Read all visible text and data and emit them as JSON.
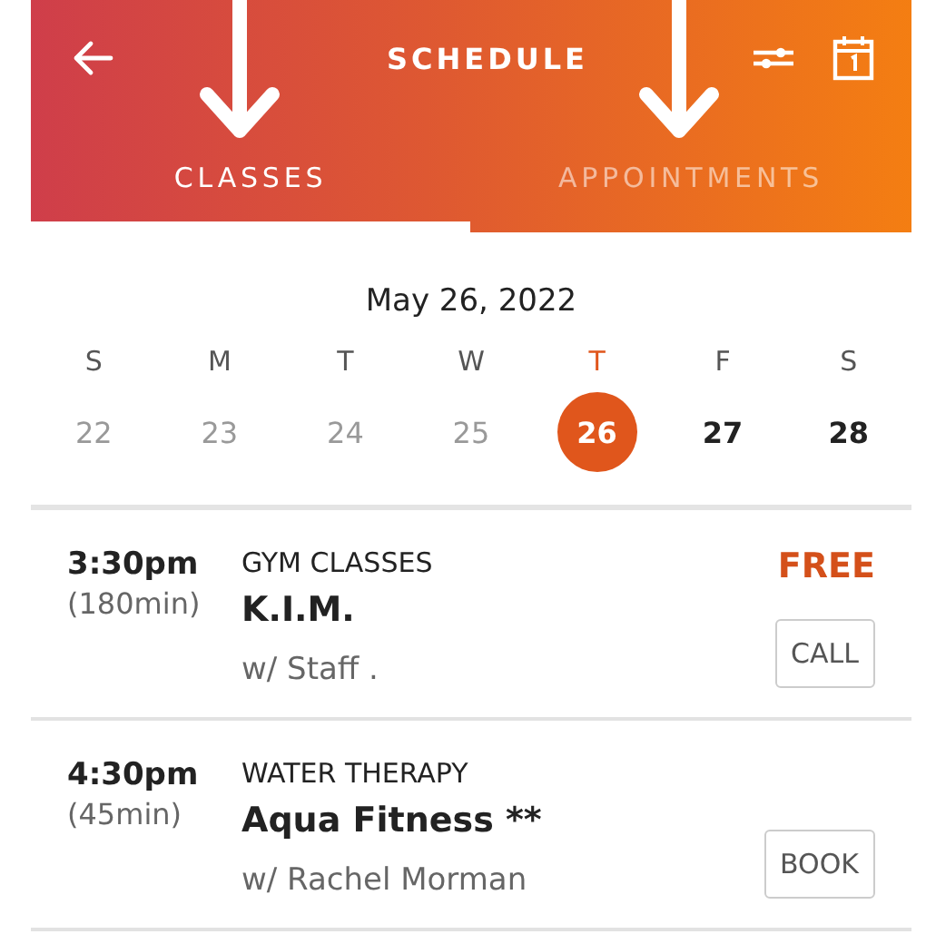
{
  "header": {
    "title": "SCHEDULE"
  },
  "tabs": [
    {
      "label": "CLASSES",
      "selected": true
    },
    {
      "label": "APPOINTMENTS",
      "selected": false
    }
  ],
  "date": "May 26, 2022",
  "days": [
    {
      "weekday": "S",
      "day": "22",
      "past": true,
      "selected": false
    },
    {
      "weekday": "M",
      "day": "23",
      "past": true,
      "selected": false
    },
    {
      "weekday": "T",
      "day": "24",
      "past": true,
      "selected": false
    },
    {
      "weekday": "W",
      "day": "25",
      "past": true,
      "selected": false
    },
    {
      "weekday": "T",
      "day": "26",
      "past": false,
      "selected": true
    },
    {
      "weekday": "F",
      "day": "27",
      "past": false,
      "selected": false
    },
    {
      "weekday": "S",
      "day": "28",
      "past": false,
      "selected": false
    }
  ],
  "classes": [
    {
      "time": "3:30pm",
      "duration": "(180min)",
      "category": "GYM CLASSES",
      "name": "K.I.M.",
      "instructor": "w/ Staff .",
      "price": "FREE",
      "action": "CALL"
    },
    {
      "time": "4:30pm",
      "duration": "(45min)",
      "category": "WATER THERAPY",
      "name": "Aqua Fitness **",
      "instructor": "w/ Rachel Morman",
      "action": "BOOK"
    }
  ]
}
